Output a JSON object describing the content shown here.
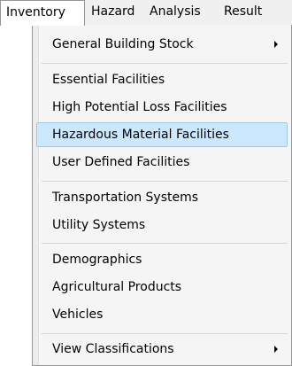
{
  "menubar": {
    "items": [
      {
        "label": "Inventory"
      },
      {
        "label": "Hazard"
      },
      {
        "label": "Analysis"
      },
      {
        "label": "Result"
      }
    ]
  },
  "dropdown": {
    "items": [
      {
        "label": "General Building Stock",
        "submenu": true,
        "highlighted": false
      },
      {
        "label": "Essential Facilities",
        "submenu": false,
        "highlighted": false
      },
      {
        "label": "High Potential Loss Facilities",
        "submenu": false,
        "highlighted": false
      },
      {
        "label": "Hazardous Material Facilities",
        "submenu": false,
        "highlighted": true
      },
      {
        "label": "User Defined Facilities",
        "submenu": false,
        "highlighted": false
      },
      {
        "label": "Transportation Systems",
        "submenu": false,
        "highlighted": false
      },
      {
        "label": "Utility Systems",
        "submenu": false,
        "highlighted": false
      },
      {
        "label": "Demographics",
        "submenu": false,
        "highlighted": false
      },
      {
        "label": "Agricultural Products",
        "submenu": false,
        "highlighted": false
      },
      {
        "label": "Vehicles",
        "submenu": false,
        "highlighted": false
      },
      {
        "label": "View Classifications",
        "submenu": true,
        "highlighted": false
      }
    ]
  }
}
